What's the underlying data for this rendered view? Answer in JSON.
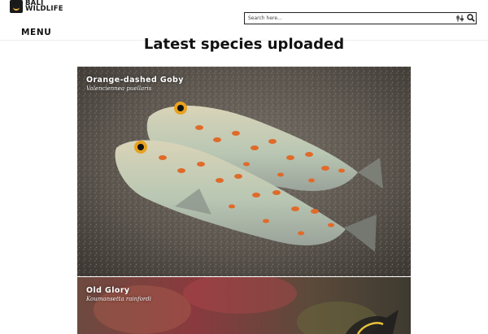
{
  "header": {
    "logo_line1": "BALI",
    "logo_line2": "WILDLIFE",
    "search_placeholder": "Search here...",
    "menu_label": "MENU"
  },
  "main": {
    "title": "Latest species uploaded",
    "cards": [
      {
        "common_name": "Orange-dashed Goby",
        "scientific_name": "Valenciennea puellaris"
      },
      {
        "common_name": "Old Glory",
        "scientific_name": "Koumansetta rainfordi"
      }
    ]
  },
  "colors": {
    "accent": "#e8b23a",
    "text": "#111111",
    "fish_body": "#c9c3a5",
    "fish_spot": "#e06a2a",
    "sand": "#5f5a54"
  }
}
